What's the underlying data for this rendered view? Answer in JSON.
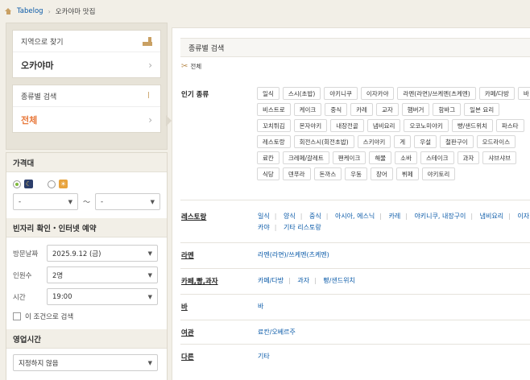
{
  "breadcrumb": {
    "home": "Tabelog",
    "current": "오카야마 맛집"
  },
  "area": {
    "title": "지역으로 찾기",
    "value": "오카야마"
  },
  "genre": {
    "title": "종류별 검색",
    "value": "전체"
  },
  "filters": {
    "price": {
      "title": "가격대",
      "from": "-",
      "to": "-",
      "tilde": "〜"
    },
    "reserve": {
      "title": "빈자리 확인・인터넷 예약",
      "date_label": "방문날짜",
      "date_value": "2025.9.12 (금)",
      "people_label": "인원수",
      "people_value": "2명",
      "time_label": "시간",
      "time_value": "19:00",
      "checkbox_label": "이 조건으로 검색"
    },
    "hours": {
      "title": "영업시간",
      "value": "지정하지 않음"
    }
  },
  "main": {
    "title": "종류별 검색",
    "crumb": "전체",
    "popular": {
      "label": "인기 종류",
      "tags": [
        "일식",
        "스시(초밥)",
        "야키니쿠",
        "이자카야",
        "라멘(라면)/쓰케멘(츠케멘)",
        "카페/다방",
        "바",
        "비스트로",
        "케이크",
        "중식",
        "카레",
        "교자",
        "햄버거",
        "함바그",
        "일본 요리",
        "꼬치튀김",
        "몬자야키",
        "내장전골",
        "냄비요리",
        "오코노미야키",
        "빵/샌드위치",
        "파스타",
        "레스토랑",
        "회전스시(회전초밥)",
        "스키야키",
        "게",
        "우설",
        "철판구이",
        "오드라이스",
        "료칸",
        "크레페/갈레트",
        "팬케이크",
        "해물",
        "소바",
        "스테이크",
        "과자",
        "샤브샤브",
        "식당",
        "덴푸라",
        "돈까스",
        "우동",
        "장어",
        "뷔페",
        "야키토리"
      ]
    },
    "sections": [
      {
        "label": "레스토랑",
        "links": [
          "일식",
          "양식",
          "중식",
          "아시아, 에스닉",
          "카레",
          "야키니쿠, 내장구이",
          "냄비요리",
          "이자카야",
          "기타 리스토랑"
        ]
      },
      {
        "label": "라멘",
        "links": [
          "라멘(라면)/쓰케멘(츠케멘)"
        ]
      },
      {
        "label": "카페,빵,과자",
        "links": [
          "카페/다방",
          "과자",
          "빵/샌드위치"
        ]
      },
      {
        "label": "바",
        "links": [
          "바"
        ]
      },
      {
        "label": "여관",
        "links": [
          "료칸/오베르주"
        ]
      },
      {
        "label": "다른",
        "links": [
          "기타"
        ]
      }
    ]
  }
}
